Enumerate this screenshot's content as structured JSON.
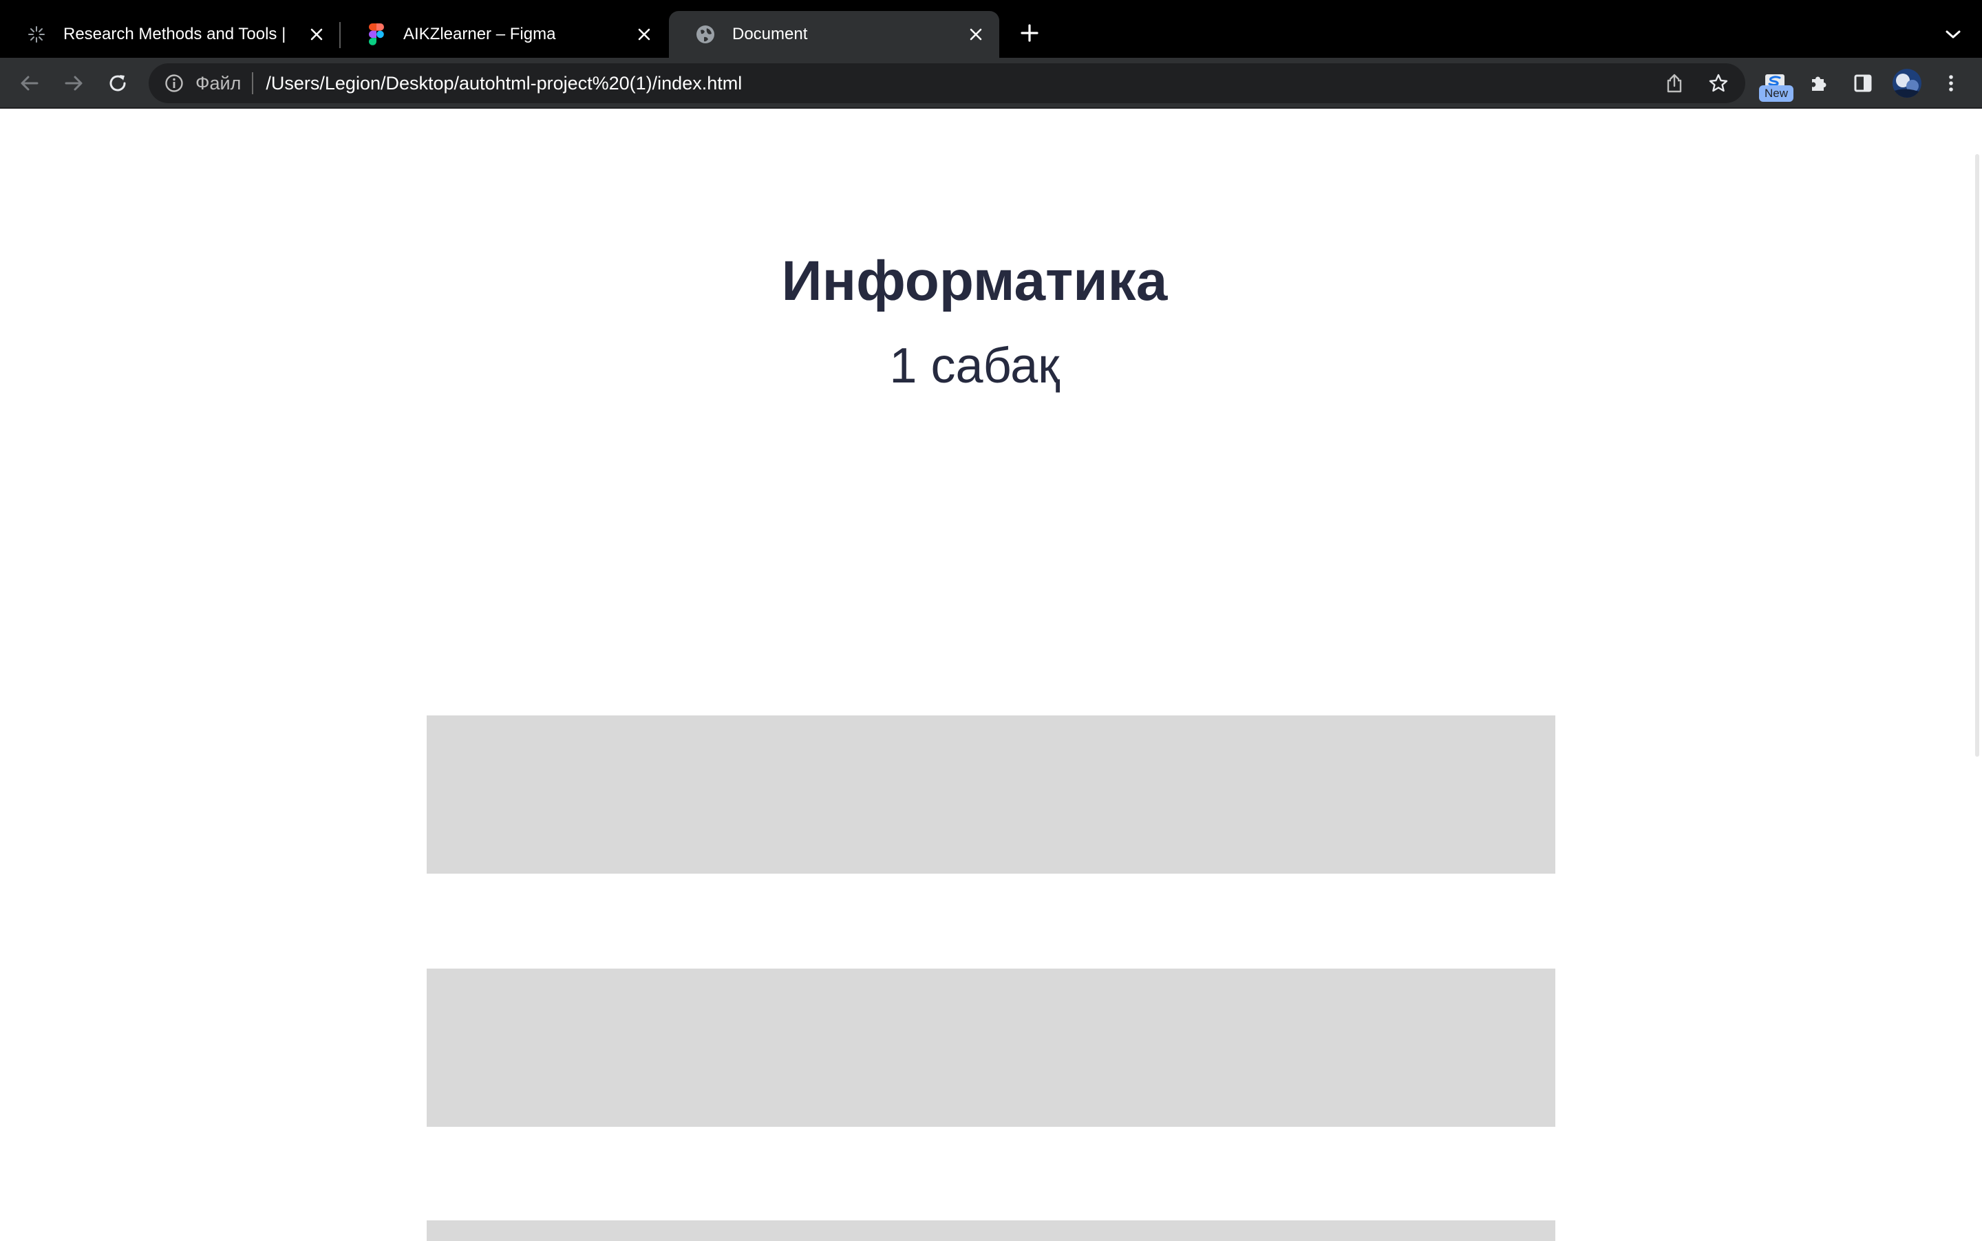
{
  "browser": {
    "tabs": [
      {
        "title": "Research Methods and Tools |",
        "favicon": "spark-icon",
        "active": false
      },
      {
        "title": "AIKZlearner – Figma",
        "favicon": "figma-icon",
        "active": false
      },
      {
        "title": "Document",
        "favicon": "globe-icon",
        "active": true
      }
    ],
    "address_bar": {
      "scheme_label": "Файл",
      "url": "/Users/Legion/Desktop/autohtml-project%20(1)/index.html"
    },
    "extension_badge": "New",
    "colors": {
      "tabbar_bg": "#000000",
      "toolbar_bg": "#2f3133",
      "omnibox_bg": "#1f2022",
      "badge_bg": "#8ab4f8"
    }
  },
  "page": {
    "title": "Информатика",
    "subtitle": "1 сабақ",
    "colors": {
      "text": "#262a3f",
      "placeholder_block": "#d9d9d9"
    }
  }
}
